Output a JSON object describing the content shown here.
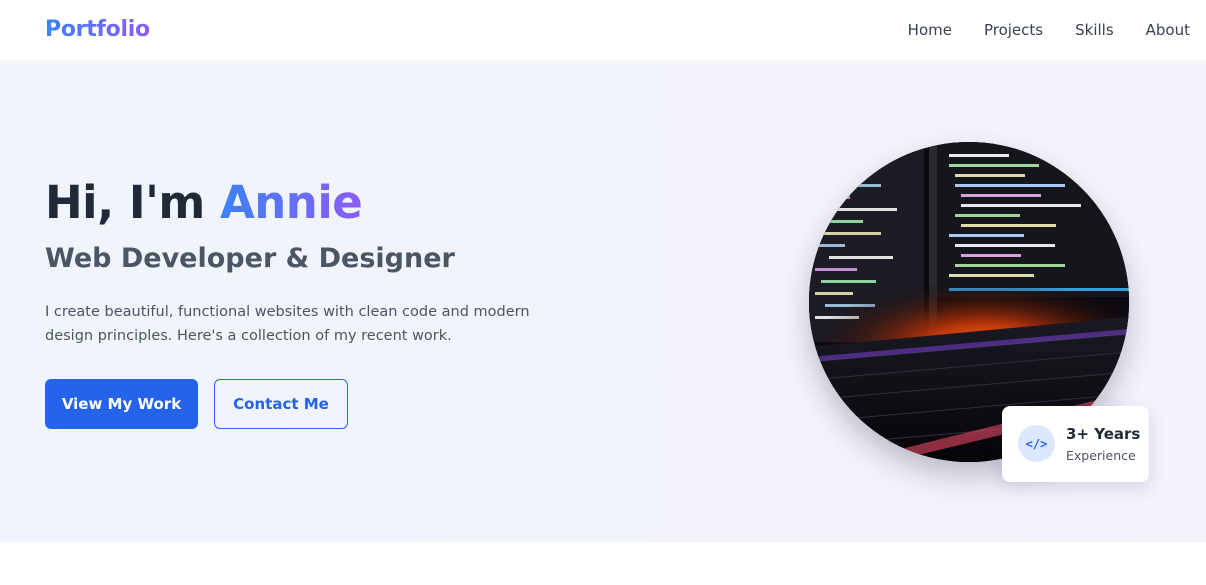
{
  "nav": {
    "logo": "Portfolio",
    "links": [
      "Home",
      "Projects",
      "Skills",
      "About"
    ]
  },
  "hero": {
    "greeting": "Hi, I'm ",
    "name": "Annie",
    "subtitle": "Web Developer & Designer",
    "description": "I create beautiful, functional websites with clean code and modern design principles. Here's a collection of my recent work.",
    "primary_button": "View My Work",
    "secondary_button": "Contact Me"
  },
  "image": {
    "icon": "code-screen-keyboard-photo"
  },
  "experience_badge": {
    "icon": "code-icon",
    "icon_glyph": "</>",
    "years": "3+ Years",
    "label": "Experience"
  },
  "colors": {
    "accent": "#2563eb",
    "gradient_start": "#3b82f6",
    "gradient_end": "#8b5cf6",
    "hero_bg": "#f0f4fd",
    "heading": "#1f2937",
    "body_text": "#4b5563"
  }
}
